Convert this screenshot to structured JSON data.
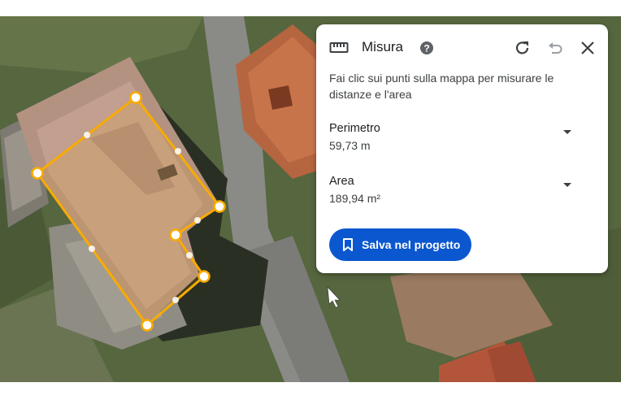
{
  "panel": {
    "title": "Misura",
    "description": "Fai clic sui punti sulla mappa per misurare le distanze e l'area",
    "perimeter_label": "Perimetro",
    "perimeter_value": "59,73 m",
    "area_label": "Area",
    "area_value": "189,94 m²",
    "save_label": "Salva nel progetto"
  },
  "icons": {
    "ruler": "ruler-icon",
    "help": "help-circle-icon",
    "redo": "redo-icon",
    "undo": "undo-icon",
    "close": "close-icon",
    "bookmark": "bookmark-icon"
  },
  "colors": {
    "measure_line": "#f9ab00",
    "accent_button": "#0b57d0",
    "undo_disabled": "#9aa0a6"
  }
}
